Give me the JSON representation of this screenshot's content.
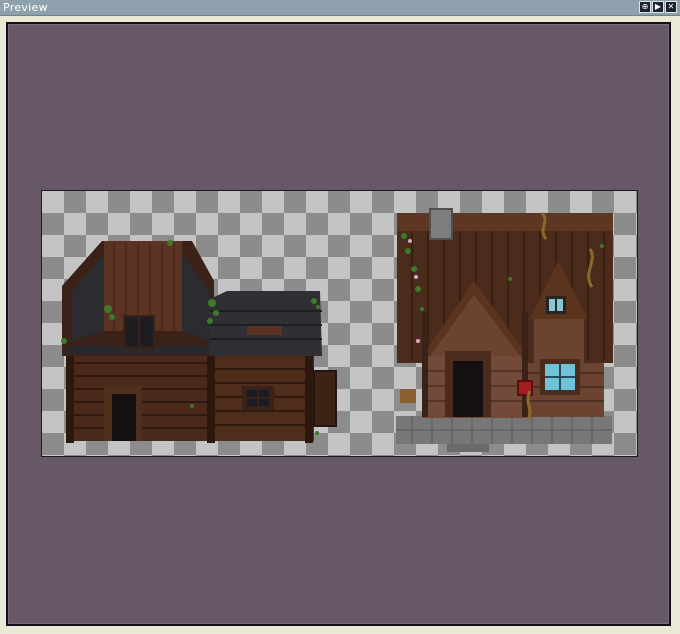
{
  "window": {
    "title": "Preview",
    "buttons": [
      {
        "icon": "resize-icon",
        "glyph": "⊕"
      },
      {
        "icon": "play-icon",
        "glyph": "▶"
      },
      {
        "icon": "close-icon",
        "glyph": "✕"
      }
    ]
  },
  "colors": {
    "titlebar": "#8ea1ad",
    "panel_background": "#675868",
    "checker_dark": "#8c8c8c",
    "checker_light": "#c4c4c4",
    "wood_dark": "#3e2418",
    "wood_mid": "#5c3520",
    "roof_slate": "#2e2e32",
    "stone": "#6f6f6f",
    "vine_green": "#3f7a2a"
  },
  "preview": {
    "sprites": [
      {
        "name": "log-cabin-sprite"
      },
      {
        "name": "farmhouse-sprite"
      }
    ]
  }
}
